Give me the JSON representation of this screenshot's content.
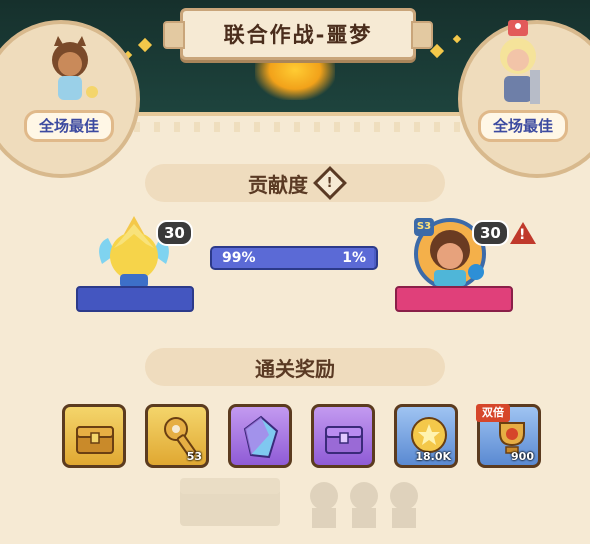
{
  "title": "联合作战-噩梦",
  "mvp": {
    "left_label": "全场最佳",
    "right_label": "全场最佳"
  },
  "contribution": {
    "header": "贡献度",
    "header_icon": "warning-diamond-icon",
    "left": {
      "level": "30",
      "percent_text": "99%",
      "bar_color": "#4456c0",
      "percent": 99
    },
    "right": {
      "level": "30",
      "percent_text": "1%",
      "bar_color": "#e0407a",
      "badge": "S3",
      "alert_icon": "warning-triangle-icon",
      "percent": 1
    }
  },
  "rewards": {
    "header": "通关奖励",
    "items": [
      {
        "name": "gold-chest",
        "icon": "chest-icon",
        "qty": "",
        "tier": "gold"
      },
      {
        "name": "key",
        "icon": "key-icon",
        "qty": "53",
        "tier": "gold"
      },
      {
        "name": "crystal",
        "icon": "crystal-icon",
        "qty": "",
        "tier": "purple"
      },
      {
        "name": "purple-chest",
        "icon": "chest-icon",
        "qty": "",
        "tier": "purple"
      },
      {
        "name": "coin",
        "icon": "star-coin-icon",
        "qty": "18.0K",
        "tier": "blue"
      },
      {
        "name": "trophy",
        "icon": "trophy-icon",
        "qty": "900",
        "tier": "blue",
        "tag": "双倍"
      }
    ]
  }
}
